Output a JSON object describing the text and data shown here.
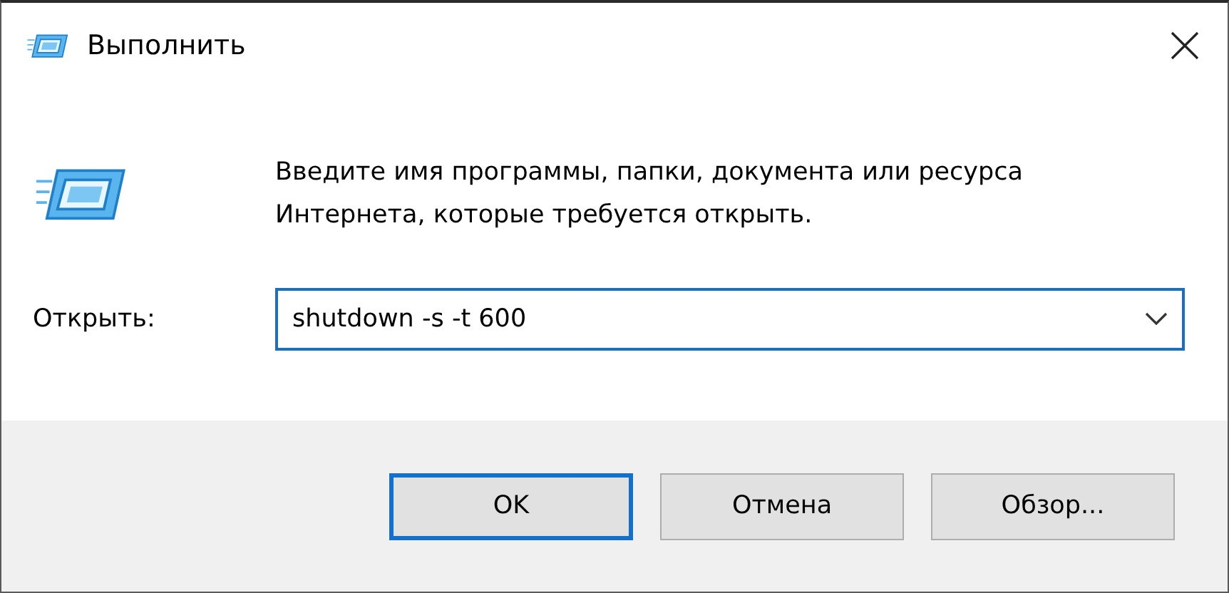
{
  "window": {
    "title": "Выполнить"
  },
  "description": "Введите имя программы, папки, документа или ресурса Интернета, которые требуется открыть.",
  "open_field": {
    "label": "Открыть:",
    "value": "shutdown -s -t 600"
  },
  "buttons": [
    {
      "label": "OK",
      "selected": true
    },
    {
      "label": "Отмена",
      "selected": false
    },
    {
      "label": "Обзор...",
      "selected": false
    }
  ]
}
